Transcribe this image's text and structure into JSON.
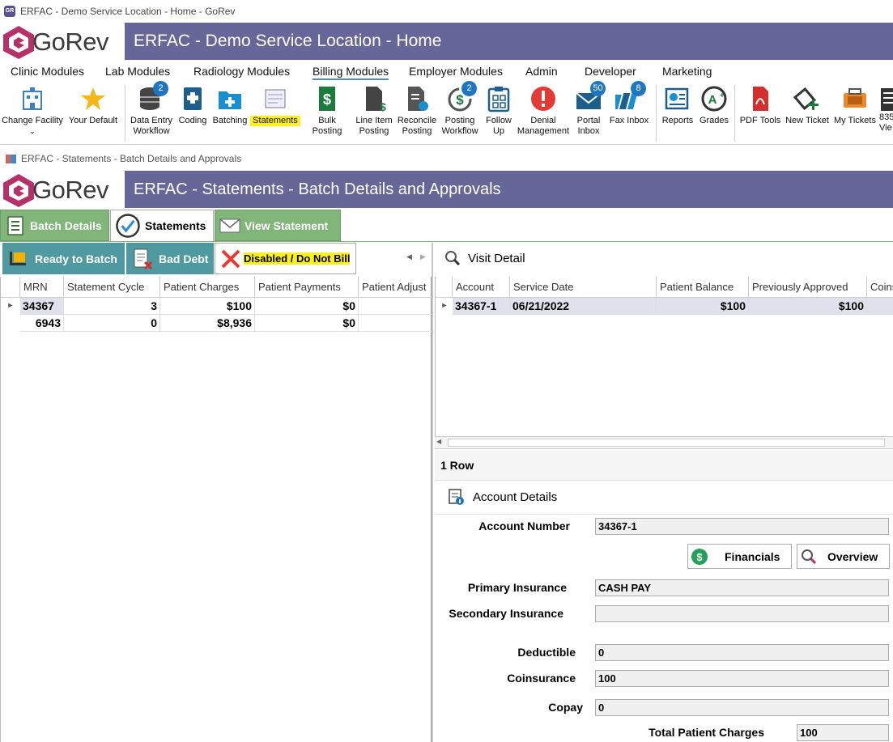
{
  "window": {
    "title": "ERFAC - Demo Service Location - Home - GoRev"
  },
  "brand": {
    "logo_text": "GoRev"
  },
  "header": {
    "title": "ERFAC - Demo Service Location - Home"
  },
  "menu": {
    "items": [
      "Clinic Modules",
      "Lab Modules",
      "Radiology Modules",
      "Billing Modules",
      "Employer Modules",
      "Admin",
      "Developer",
      "Marketing"
    ],
    "active": "Billing Modules"
  },
  "ribbon": {
    "change_facility": "Change Facility",
    "your_default": "Your Default",
    "data_entry_1": "Data Entry",
    "data_entry_2": "Workflow",
    "data_entry_badge": "2",
    "coding": "Coding",
    "batching": "Batching",
    "statements": "Statements",
    "bulk_posting": "Bulk Posting",
    "line_item_1": "Line Item",
    "line_item_2": "Posting",
    "reconcile_1": "Reconcile",
    "reconcile_2": "Posting",
    "posting_wf_1": "Posting",
    "posting_wf_2": "Workflow",
    "posting_wf_badge": "2",
    "follow_1": "Follow",
    "follow_2": "Up",
    "denial_1": "Denial",
    "denial_2": "Management",
    "portal_1": "Portal",
    "portal_2": "Inbox",
    "portal_badge": "50",
    "fax_inbox": "Fax Inbox",
    "fax_badge": "8",
    "reports": "Reports",
    "grades": "Grades",
    "pdf_tools": "PDF Tools",
    "new_ticket": "New Ticket",
    "my_tickets": "My Tickets",
    "x835_1": "835",
    "x835_2": "Vie"
  },
  "subwindow": {
    "title": "ERFAC - Statements - Batch Details and Approvals",
    "header_title": "ERFAC - Statements - Batch Details and Approvals"
  },
  "tabs": {
    "batch_details": "Batch Details",
    "statements": "Statements",
    "view_statement": "View Statement"
  },
  "subtabs": {
    "ready": "Ready to Batch",
    "bad_debt": "Bad Debt",
    "disabled": "Disabled / Do Not Bill"
  },
  "left_grid": {
    "columns": [
      "MRN",
      "Statement Cycle",
      "Patient Charges",
      "Patient Payments",
      "Patient Adjust"
    ],
    "rows": [
      [
        "34367",
        "3",
        "$100",
        "$0",
        ""
      ],
      [
        "6943",
        "0",
        "$8,936",
        "$0",
        ""
      ]
    ]
  },
  "visit_detail": {
    "title": "Visit Detail",
    "columns": [
      "Account",
      "Service Date",
      "Patient Balance",
      "Previously Approved",
      "Coins"
    ],
    "rows": [
      [
        "34367-1",
        "06/21/2022",
        "$100",
        "$100",
        ""
      ]
    ],
    "row_count": "1 Row"
  },
  "account_details": {
    "title": "Account Details",
    "account_number_label": "Account Number",
    "account_number": "34367-1",
    "financials_btn": "Financials",
    "overview_btn": "Overview",
    "primary_label": "Primary Insurance",
    "primary": "CASH PAY",
    "secondary_label": "Secondary Insurance",
    "secondary": "",
    "deductible_label": "Deductible",
    "deductible": "0",
    "coinsurance_label": "Coinsurance",
    "coinsurance": "100",
    "copay_label": "Copay",
    "copay": "0",
    "total_label": "Total Patient Charges",
    "total": "100"
  },
  "colors": {
    "header_band": "#676699",
    "tab_green": "#82b57a",
    "subtab_teal": "#4f9aa1",
    "highlight": "#ffef1a",
    "badge": "#1e76c1"
  }
}
